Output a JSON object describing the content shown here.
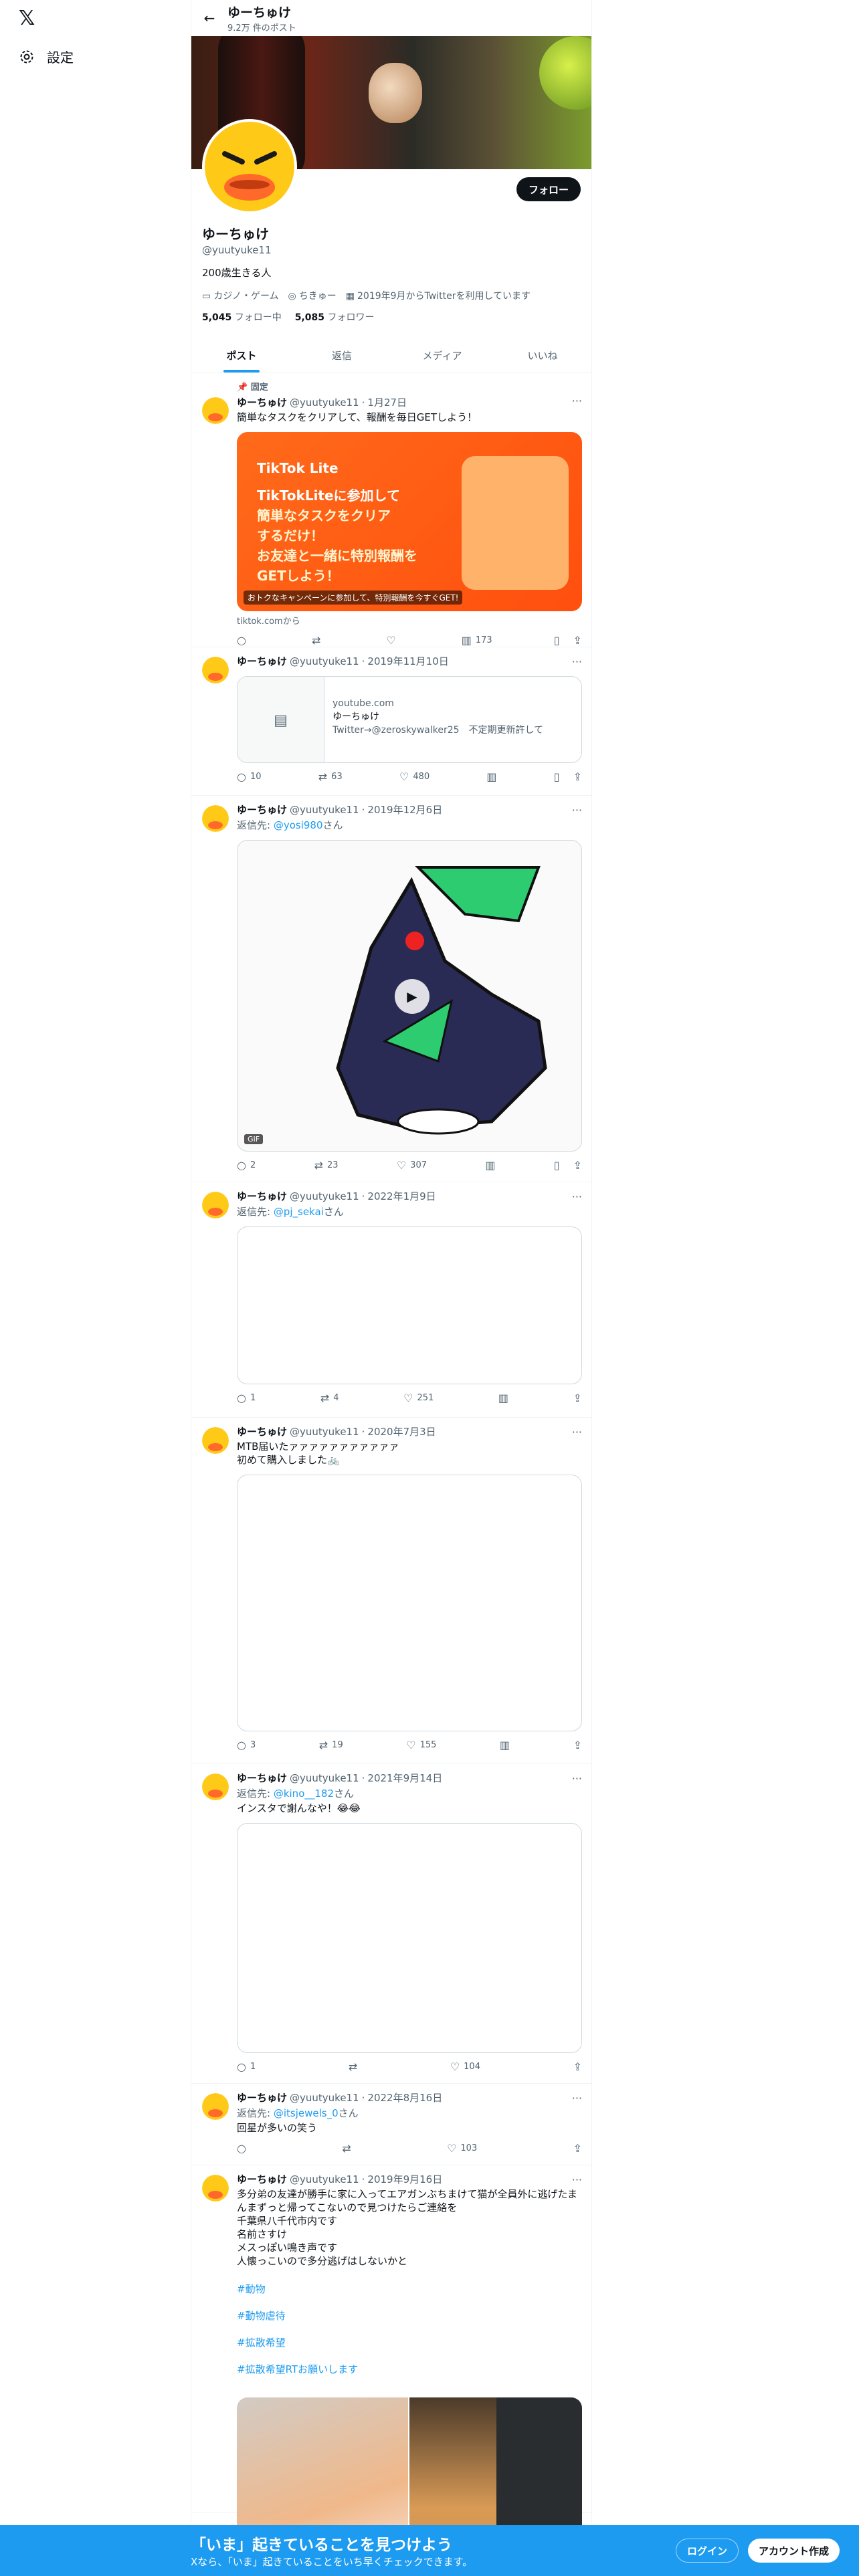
{
  "nav": {
    "logo": "𝕏",
    "settings_label": "設定"
  },
  "header": {
    "name": "ゆーちゅけ",
    "post_count": "9.2万 件のポスト"
  },
  "profile": {
    "name": "ゆーちゅけ",
    "handle": "@yuutyuke11",
    "follow_label": "フォロー",
    "bio": "200歳生きる人",
    "category": "カジノ・ゲーム",
    "location": "ちきゅー",
    "joined": "2019年9月からTwitterを利用しています",
    "following_count": "5,045",
    "following_label": "フォロー中",
    "followers_count": "5,085",
    "followers_label": "フォロワー"
  },
  "tabs": [
    {
      "label": "ポスト"
    },
    {
      "label": "返信"
    },
    {
      "label": "メディア"
    },
    {
      "label": "いいね"
    }
  ],
  "posts": [
    {
      "pinned": "固定",
      "name": "ゆーちゅけ",
      "handle": "@yuutyuke11",
      "date": "1月27日",
      "text": "簡単なタスクをクリアして、報酬を毎日GETしよう！",
      "ad": {
        "brand": "TikTok Lite",
        "l1": "TikTokLiteに参加して",
        "l2": "簡単なタスクをクリア",
        "l3": "するだけ！",
        "l4": "お友達と一緒に特別報酬を",
        "l5": "GETしよう！",
        "caption": "おトクなキャンペーンに参加して、特別報酬を今すぐGET!"
      },
      "source": "tiktok.comから",
      "replies": "",
      "retweets": "",
      "likes": "",
      "views": "173"
    },
    {
      "name": "ゆーちゅけ",
      "handle": "@yuutyuke11",
      "date": "2019年11月10日",
      "card": {
        "domain": "youtube.com",
        "title": "ゆーちゅけ",
        "desc": "Twitter→@zeroskywalker25　不定期更新許して"
      },
      "replies": "10",
      "retweets": "63",
      "likes": "480",
      "views": ""
    },
    {
      "name": "ゆーちゅけ",
      "handle": "@yuutyuke11",
      "date": "2019年12月6日",
      "reply_prefix": "返信先: ",
      "reply_to": "@yosi980",
      "reply_suffix": "さん",
      "video_badge": "GIF",
      "replies": "2",
      "retweets": "23",
      "likes": "307",
      "views": ""
    },
    {
      "name": "ゆーちゅけ",
      "handle": "@yuutyuke11",
      "date": "2022年1月9日",
      "reply_prefix": "返信先: ",
      "reply_to": "@pj_sekai",
      "reply_suffix": "さん",
      "replies": "1",
      "retweets": "4",
      "likes": "251",
      "views": ""
    },
    {
      "name": "ゆーちゅけ",
      "handle": "@yuutyuke11",
      "date": "2020年7月3日",
      "text": "MTB届いたァァァァァァァァァァァ\n初めて購入しました🚲",
      "replies": "3",
      "retweets": "19",
      "likes": "155",
      "views": ""
    },
    {
      "name": "ゆーちゅけ",
      "handle": "@yuutyuke11",
      "date": "2021年9月14日",
      "reply_prefix": "返信先: ",
      "reply_to": "@kino__182",
      "reply_suffix": "さん",
      "text": "インスタで謝んなや！😂😂",
      "replies": "1",
      "retweets": "",
      "likes": "104",
      "views": ""
    },
    {
      "name": "ゆーちゅけ",
      "handle": "@yuutyuke11",
      "date": "2022年8月16日",
      "reply_prefix": "返信先: ",
      "reply_to": "@itsjewels_0",
      "reply_suffix": "さん",
      "text": "回星が多いの笑う",
      "replies": "",
      "retweets": "",
      "likes": "103",
      "views": ""
    },
    {
      "name": "ゆーちゅけ",
      "handle": "@yuutyuke11",
      "date": "2019年9月16日",
      "text": "多分弟の友達が勝手に家に入ってエアガンぶちまけて猫が全員外に逃げたまんまずっと帰ってこないので見つけたらご連絡を\n千葉県八千代市内です\n名前さすけ\nメスっぽい鳴き声です\n人懐っこいので多分逃げはしないかと",
      "tags": [
        "#動物",
        "#動物虐待",
        "#拡散希望",
        "#拡散希望RTお願いします"
      ]
    }
  ],
  "bottom": {
    "title": "「いま」起きていることを見つけよう",
    "subtitle": "Xなら、「いま」起きていることをいち早くチェックできます。",
    "login": "ログイン",
    "signup": "アカウント作成"
  },
  "colors": {
    "accent": "#1d9bf0",
    "text": "#0f1419",
    "muted": "#536471"
  }
}
